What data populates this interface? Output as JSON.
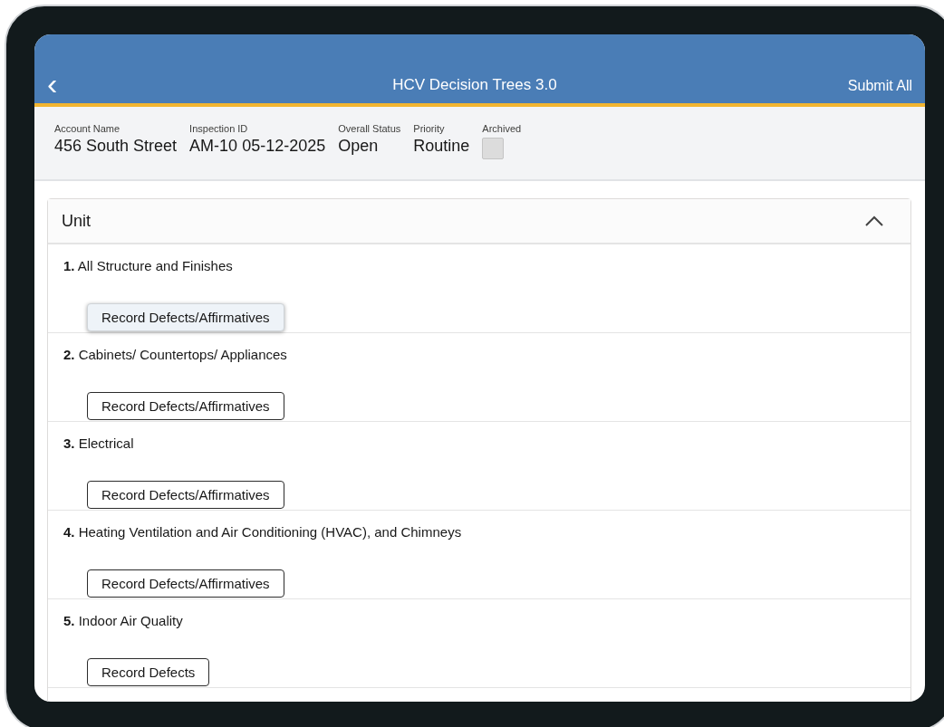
{
  "header": {
    "back": "‹",
    "title": "HCV Decision Trees 3.0",
    "action": "Submit All"
  },
  "fields": [
    {
      "label": "Account Name",
      "value": "456 South Street",
      "kind": "text"
    },
    {
      "label": "Inspection ID",
      "value": "AM-10 05-12-2025",
      "kind": "text"
    },
    {
      "label": "Overall Status",
      "value": "Open",
      "kind": "text"
    },
    {
      "label": "Priority",
      "value": "Routine",
      "kind": "text"
    },
    {
      "label": "Archived",
      "checked": false,
      "kind": "checkbox"
    }
  ],
  "section": {
    "title": "Unit",
    "expanded": true,
    "items": [
      {
        "label": "**1.** All Structure and Finishes",
        "button": "Record Defects/Affirmatives",
        "selected": true
      },
      {
        "label": "**2.** Cabinets/ Countertops/ Appliances",
        "button": "Record Defects/Affirmatives",
        "selected": false
      },
      {
        "label": "**3.** Electrical",
        "button": "Record Defects/Affirmatives",
        "selected": false
      },
      {
        "label": "**4.** Heating Ventilation and Air Conditioning (HVAC), and Chimneys",
        "button": "Record Defects/Affirmatives",
        "selected": false
      },
      {
        "label": "**5.** Indoor Air Quality",
        "button": "Record Defects",
        "selected": false
      }
    ]
  }
}
